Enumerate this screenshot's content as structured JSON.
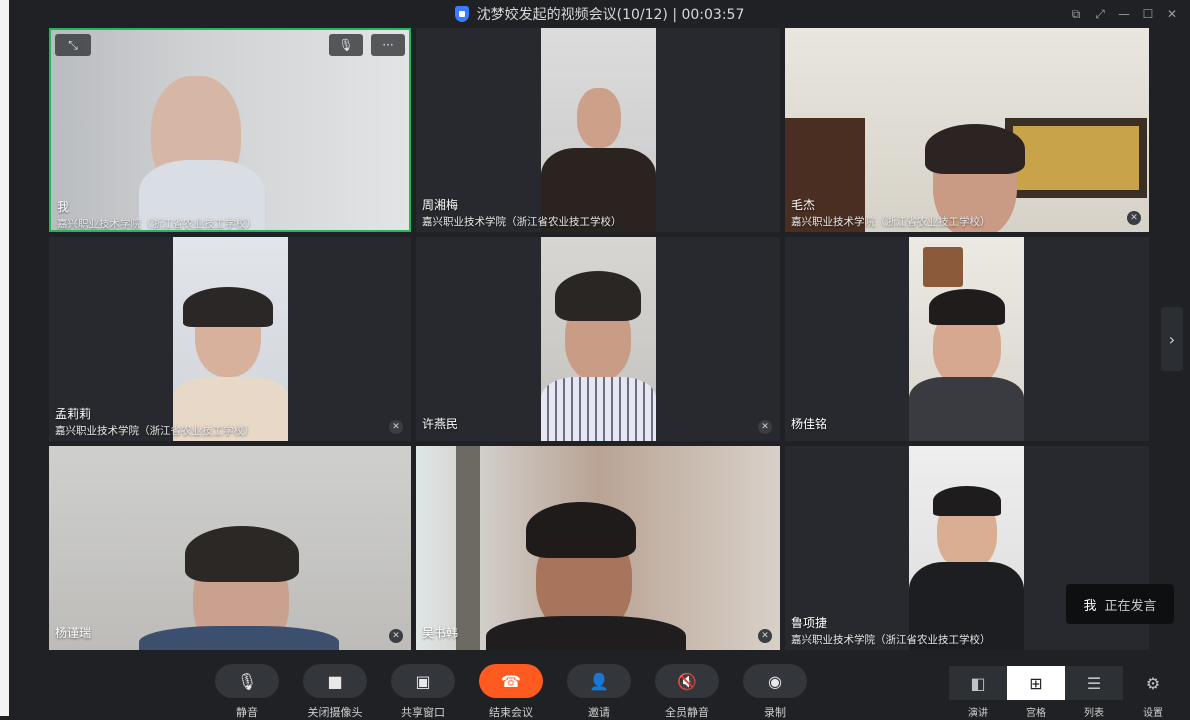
{
  "window": {
    "title": "沈梦姣发起的视频会议(10/12) | 00:03:57"
  },
  "tiles": [
    {
      "name": "我",
      "org": "嘉兴职业技术学院（浙江省农业技工学校）",
      "muted": false
    },
    {
      "name": "周湘梅",
      "org": "嘉兴职业技术学院（浙江省农业技工学校）",
      "muted": false
    },
    {
      "name": "毛杰",
      "org": "嘉兴职业技术学院（浙江省农业技工学校）",
      "muted": true
    },
    {
      "name": "孟莉莉",
      "org": "嘉兴职业技术学院（浙江省农业技工学校）",
      "muted": true
    },
    {
      "name": "许燕民",
      "org": "",
      "muted": true
    },
    {
      "name": "杨佳铭",
      "org": "",
      "muted": false
    },
    {
      "name": "杨谨瑞",
      "org": "",
      "muted": true
    },
    {
      "name": "吴书韩",
      "org": "",
      "muted": true
    },
    {
      "name": "鲁项捷",
      "org": "嘉兴职业技术学院（浙江省农业技工学校）",
      "muted": false
    }
  ],
  "toolbar": {
    "mute": "静音",
    "camera_off": "关闭摄像头",
    "share": "共享窗口",
    "end": "结束会议",
    "invite": "邀请",
    "mute_all": "全员静音",
    "record": "录制"
  },
  "views": {
    "speaker": "演讲",
    "grid": "宫格",
    "list": "列表",
    "settings": "设置"
  },
  "speaking": {
    "who": "我",
    "text": "正在发言"
  },
  "brand": "钉钉"
}
